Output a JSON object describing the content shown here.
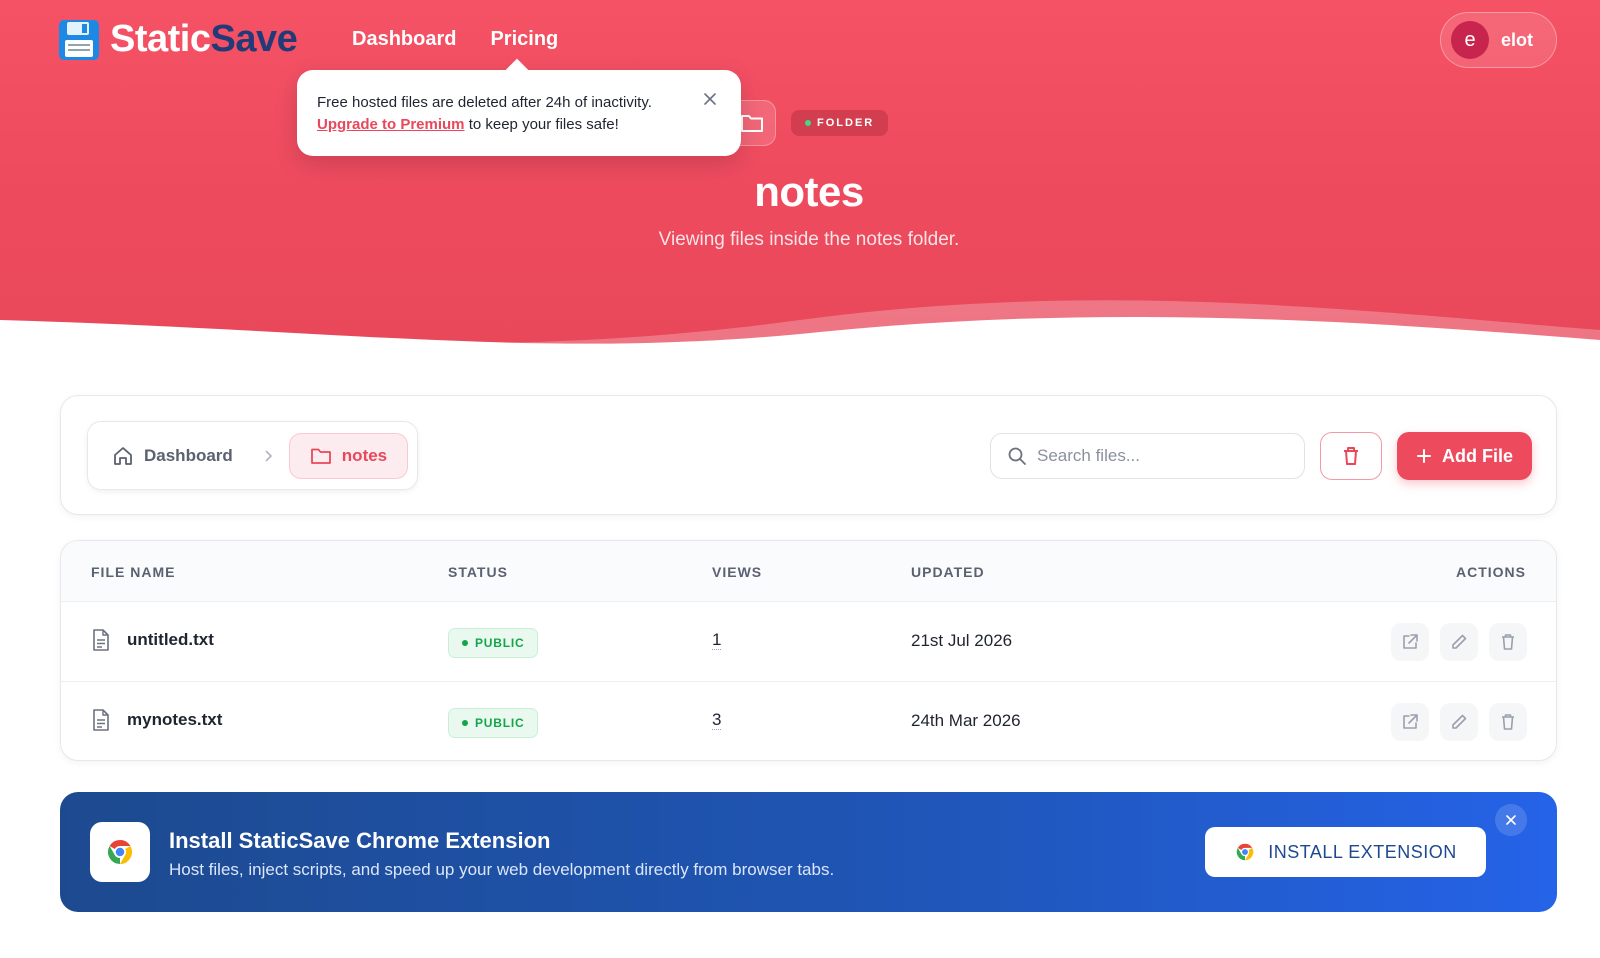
{
  "brand": {
    "name_part1": "Static",
    "name_part2": "Save",
    "accent": "#ee4a5e",
    "secondary": "#233a78"
  },
  "nav": {
    "dashboard": "Dashboard",
    "pricing": "Pricing"
  },
  "user": {
    "initial": "e",
    "name": "elot"
  },
  "tooltip": {
    "line1": "Free hosted files are deleted after 24h of inactivity.",
    "link": "Upgrade to Premium",
    "line2_rest": " to keep your files safe!"
  },
  "hero": {
    "badge": "FOLDER",
    "title": "notes",
    "subtitle": "Viewing files inside the notes folder."
  },
  "breadcrumb": {
    "home": "Dashboard",
    "current": "notes"
  },
  "search": {
    "placeholder": "Search files...",
    "value": ""
  },
  "toolbar": {
    "add_label": "Add File"
  },
  "table": {
    "headers": {
      "name": "FILE NAME",
      "status": "STATUS",
      "views": "VIEWS",
      "updated": "UPDATED",
      "actions": "ACTIONS"
    },
    "rows": [
      {
        "name": "untitled.txt",
        "status": "PUBLIC",
        "views": "1",
        "updated": "21st Jul 2026"
      },
      {
        "name": "mynotes.txt",
        "status": "PUBLIC",
        "views": "3",
        "updated": "24th Mar 2026"
      }
    ]
  },
  "extension": {
    "title": "Install StaticSave Chrome Extension",
    "subtitle": "Host files, inject scripts, and speed up your web development directly from browser tabs.",
    "button": "INSTALL EXTENSION"
  }
}
